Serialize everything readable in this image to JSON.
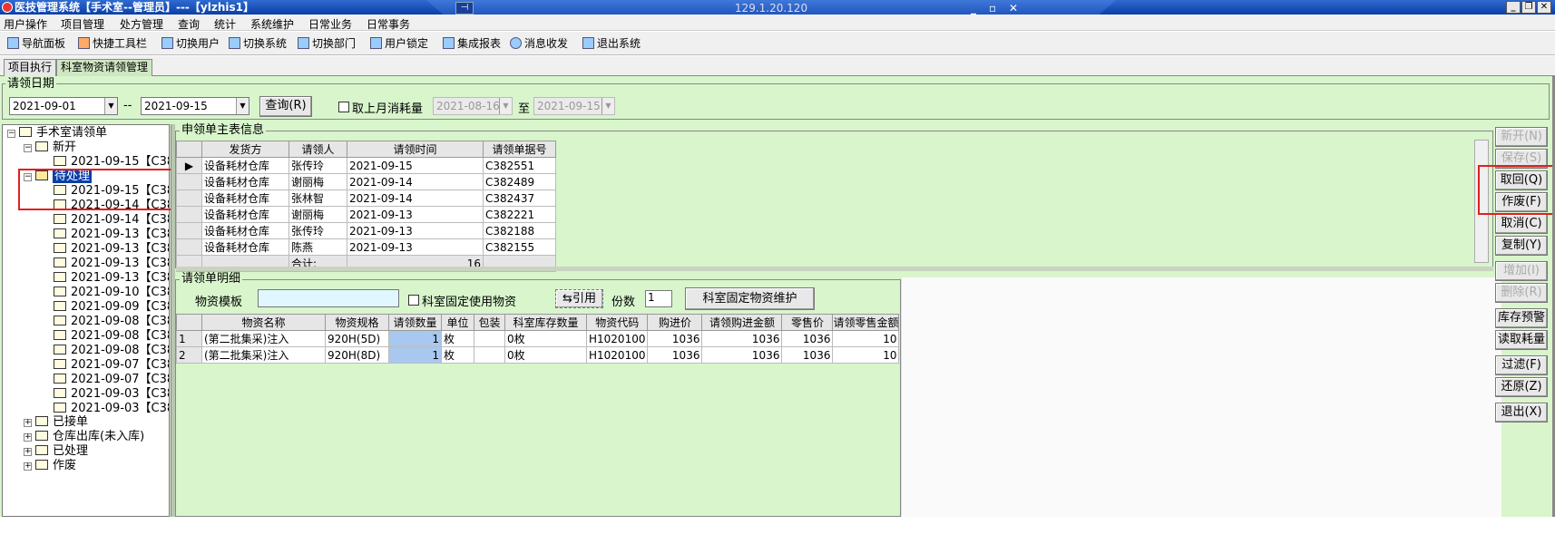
{
  "window": {
    "title": "医技管理系统【手术室--管理员】---【ylzhis1】",
    "remote_host": "129.1.20.120"
  },
  "menu": [
    "用户操作",
    "项目管理",
    "处方管理",
    "查询",
    "统计",
    "系统维护",
    "日常业务",
    "日常事务"
  ],
  "toolbar": [
    "导航面板",
    "快捷工具栏",
    "切换用户",
    "切换系统",
    "切换部门",
    "用户锁定",
    "集成报表",
    "消息收发",
    "退出系统"
  ],
  "tabs": [
    "项目执行",
    "科室物资请领管理"
  ],
  "filter": {
    "group_title": "请领日期",
    "date_from": "2021-09-01",
    "sep": "--",
    "date_to": "2021-09-15",
    "query": "查询(R)",
    "last_month_label": "取上月消耗量",
    "lm_from": "2021-08-16",
    "to_label": "至",
    "lm_to": "2021-09-15"
  },
  "tree": {
    "root": "手术室请领单",
    "new": "新开",
    "new_items": [
      "2021-09-15【C38"
    ],
    "pending": "待处理",
    "pending_items": [
      "2021-09-15【C38",
      "2021-09-14【C38",
      "2021-09-14【C38",
      "2021-09-13【C38",
      "2021-09-13【C38",
      "2021-09-13【C38",
      "2021-09-13【C38",
      "2021-09-10【C38",
      "2021-09-09【C38",
      "2021-09-08【C38",
      "2021-09-08【C38",
      "2021-09-08【C38",
      "2021-09-07【C38",
      "2021-09-07【C38",
      "2021-09-03【C38",
      "2021-09-03【C38"
    ],
    "others": [
      "已接单",
      "仓库出库(未入库)",
      "已处理",
      "作废"
    ]
  },
  "master": {
    "title": "申领单主表信息",
    "headers": [
      "发货方",
      "请领人",
      "请领时间",
      "请领单据号"
    ],
    "rows": [
      [
        "设备耗材仓库",
        "张传玲",
        "2021-09-15",
        "C382551"
      ],
      [
        "设备耗材仓库",
        "谢丽梅",
        "2021-09-14",
        "C382489"
      ],
      [
        "设备耗材仓库",
        "张林智",
        "2021-09-14",
        "C382437"
      ],
      [
        "设备耗材仓库",
        "谢丽梅",
        "2021-09-13",
        "C382221"
      ],
      [
        "设备耗材仓库",
        "张传玲",
        "2021-09-13",
        "C382188"
      ],
      [
        "设备耗材仓库",
        "陈燕",
        "2021-09-13",
        "C382155"
      ]
    ],
    "total_label": "合计:",
    "total_value": "16"
  },
  "detail": {
    "title": "请领单明细",
    "template_label": "物资模板",
    "fixed_label": "科室固定使用物资",
    "cite_button": "引用",
    "copies_label": "份数",
    "copies_value": "1",
    "maintain_button": "科室固定物资维护",
    "headers": [
      "物资名称",
      "物资规格",
      "请领数量",
      "单位",
      "包装",
      "科室库存数量",
      "物资代码",
      "购进价",
      "请领购进金额",
      "零售价",
      "请领零售金额"
    ],
    "rows": [
      [
        "1",
        "(第二批集采)注入",
        "920H(5D)",
        "1",
        "枚",
        "",
        "0枚",
        "H1020100",
        "1036",
        "1036",
        "1036",
        "10"
      ],
      [
        "2",
        "(第二批集采)注入",
        "920H(8D)",
        "1",
        "枚",
        "",
        "0枚",
        "H1020100",
        "1036",
        "1036",
        "1036",
        "10"
      ]
    ]
  },
  "side_buttons": [
    "新开(N)",
    "保存(S)",
    "取回(Q)",
    "作废(F)",
    "取消(C)",
    "复制(Y)",
    "增加(I)",
    "删除(R)",
    "库存预警",
    "读取耗量",
    "过滤(F)",
    "还原(Z)",
    "退出(X)"
  ]
}
